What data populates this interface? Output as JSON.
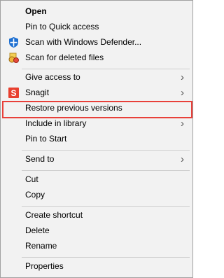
{
  "menu": {
    "open": "Open",
    "pin_quick_access": "Pin to Quick access",
    "scan_defender": "Scan with Windows Defender...",
    "scan_deleted": "Scan for deleted files",
    "give_access": "Give access to",
    "snagit": "Snagit",
    "restore_previous": "Restore previous versions",
    "include_library": "Include in library",
    "pin_start": "Pin to Start",
    "send_to": "Send to",
    "cut": "Cut",
    "copy": "Copy",
    "create_shortcut": "Create shortcut",
    "delete": "Delete",
    "rename": "Rename",
    "properties": "Properties",
    "submenu_glyph": "›"
  },
  "icons": {
    "defender": "windows-defender-shield-icon",
    "scan_deleted": "scan-deleted-files-icon",
    "snagit": "snagit-icon"
  },
  "colors": {
    "menu_background": "#f2f2f2",
    "highlight_border": "#e8403a",
    "snagit_red": "#e8402f",
    "defender_blue": "#1d6fd1"
  }
}
